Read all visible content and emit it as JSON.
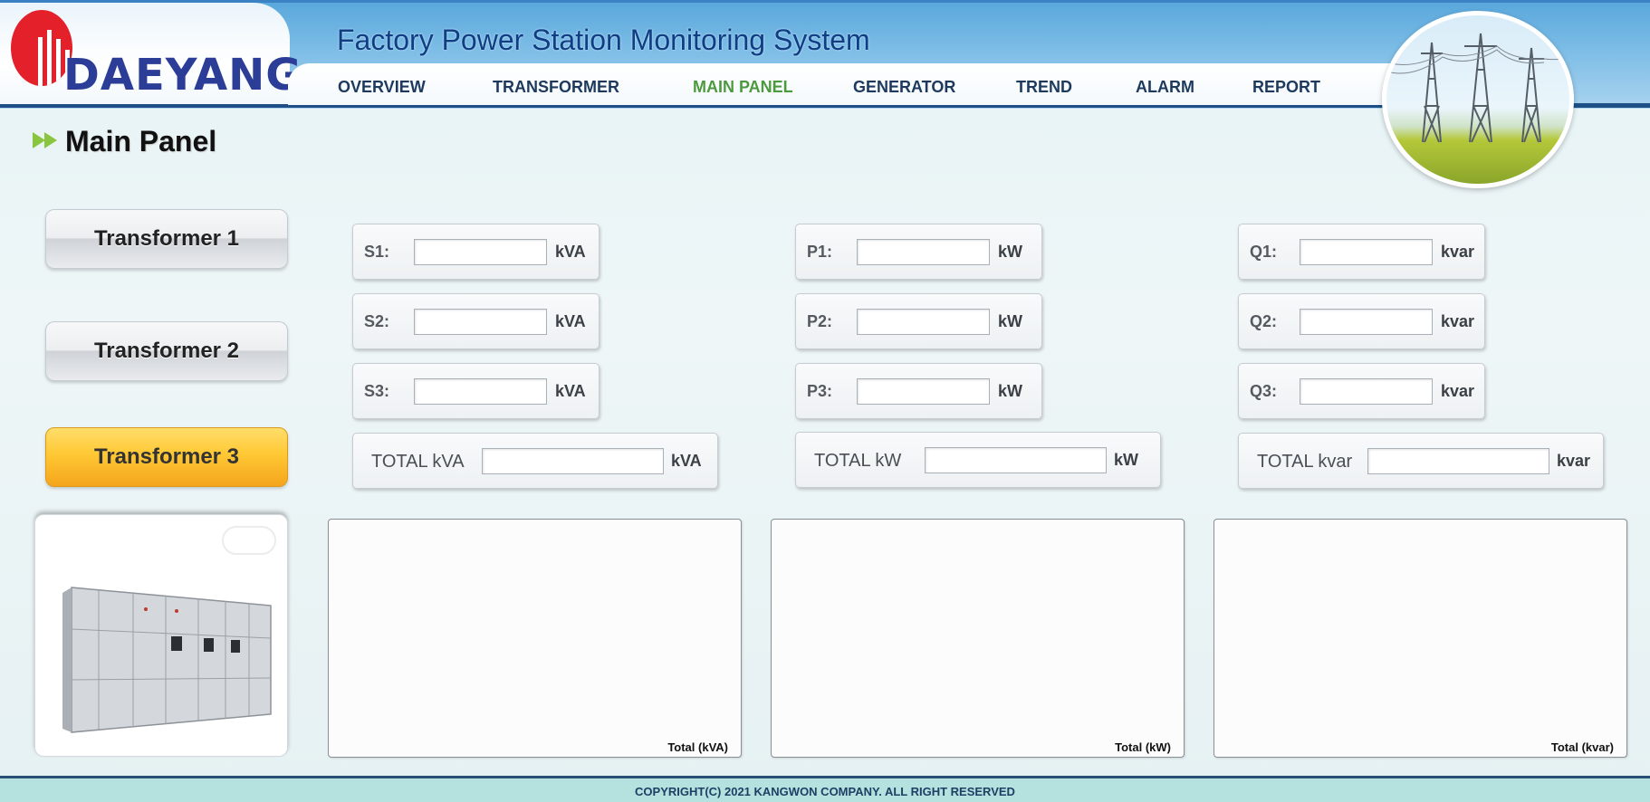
{
  "brand": {
    "logo_text": "DAEYANG",
    "color": "#2b3d96",
    "mark_color": "#e4202a"
  },
  "app_title": "Factory Power Station Monitoring System",
  "nav": {
    "items": [
      {
        "label": "OVERVIEW",
        "active": false
      },
      {
        "label": "TRANSFORMER",
        "active": false
      },
      {
        "label": "MAIN PANEL",
        "active": true
      },
      {
        "label": "GENERATOR",
        "active": false
      },
      {
        "label": "TREND",
        "active": false
      },
      {
        "label": "ALARM",
        "active": false
      },
      {
        "label": "REPORT",
        "active": false
      }
    ],
    "active_color": "#4d9a3e"
  },
  "page_title": "Main Panel",
  "transformers": [
    {
      "label": "Transformer 1",
      "selected": false
    },
    {
      "label": "Transformer 2",
      "selected": false
    },
    {
      "label": "Transformer 3",
      "selected": true
    }
  ],
  "readings": {
    "apparent": {
      "rows": [
        {
          "label": "S1:",
          "value": "",
          "unit": "kVA"
        },
        {
          "label": "S2:",
          "value": "",
          "unit": "kVA"
        },
        {
          "label": "S3:",
          "value": "",
          "unit": "kVA"
        }
      ],
      "total": {
        "label": "TOTAL kVA",
        "value": "",
        "unit": "kVA"
      }
    },
    "active": {
      "rows": [
        {
          "label": "P1:",
          "value": "",
          "unit": "kW"
        },
        {
          "label": "P2:",
          "value": "",
          "unit": "kW"
        },
        {
          "label": "P3:",
          "value": "",
          "unit": "kW"
        }
      ],
      "total": {
        "label": "TOTAL kW",
        "value": "",
        "unit": "kW"
      }
    },
    "reactive": {
      "rows": [
        {
          "label": "Q1:",
          "value": "",
          "unit": "kvar"
        },
        {
          "label": "Q2:",
          "value": "",
          "unit": "kvar"
        },
        {
          "label": "Q3:",
          "value": "",
          "unit": "kvar"
        }
      ],
      "total": {
        "label": "TOTAL kvar",
        "value": "",
        "unit": "kvar"
      }
    }
  },
  "charts": [
    {
      "label": "Total (kVA)"
    },
    {
      "label": "Total (kW)"
    },
    {
      "label": "Total (kvar)"
    }
  ],
  "footer": "COPYRIGHT(C) 2021 KANGWON COMPANY. ALL RIGHT RESERVED",
  "icons": {
    "page_title": "double-chevron-right-icon",
    "tower_photo": "power-tower-image",
    "panel_photo": "electrical-panel-image"
  }
}
